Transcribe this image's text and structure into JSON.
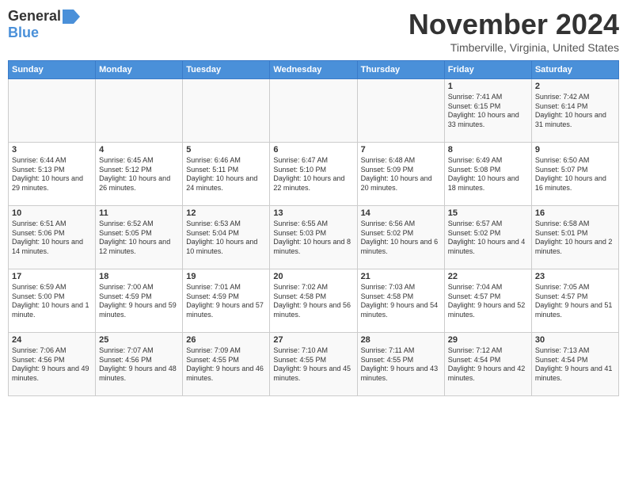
{
  "header": {
    "logo_general": "General",
    "logo_blue": "Blue",
    "month": "November 2024",
    "location": "Timberville, Virginia, United States"
  },
  "days_of_week": [
    "Sunday",
    "Monday",
    "Tuesday",
    "Wednesday",
    "Thursday",
    "Friday",
    "Saturday"
  ],
  "weeks": [
    {
      "cells": [
        {
          "day": null
        },
        {
          "day": null
        },
        {
          "day": null
        },
        {
          "day": null
        },
        {
          "day": null
        },
        {
          "day": "1",
          "sunrise": "7:41 AM",
          "sunset": "6:15 PM",
          "daylight": "10 hours and 33 minutes."
        },
        {
          "day": "2",
          "sunrise": "7:42 AM",
          "sunset": "6:14 PM",
          "daylight": "10 hours and 31 minutes."
        }
      ]
    },
    {
      "cells": [
        {
          "day": "3",
          "sunrise": "6:44 AM",
          "sunset": "5:13 PM",
          "daylight": "10 hours and 29 minutes."
        },
        {
          "day": "4",
          "sunrise": "6:45 AM",
          "sunset": "5:12 PM",
          "daylight": "10 hours and 26 minutes."
        },
        {
          "day": "5",
          "sunrise": "6:46 AM",
          "sunset": "5:11 PM",
          "daylight": "10 hours and 24 minutes."
        },
        {
          "day": "6",
          "sunrise": "6:47 AM",
          "sunset": "5:10 PM",
          "daylight": "10 hours and 22 minutes."
        },
        {
          "day": "7",
          "sunrise": "6:48 AM",
          "sunset": "5:09 PM",
          "daylight": "10 hours and 20 minutes."
        },
        {
          "day": "8",
          "sunrise": "6:49 AM",
          "sunset": "5:08 PM",
          "daylight": "10 hours and 18 minutes."
        },
        {
          "day": "9",
          "sunrise": "6:50 AM",
          "sunset": "5:07 PM",
          "daylight": "10 hours and 16 minutes."
        }
      ]
    },
    {
      "cells": [
        {
          "day": "10",
          "sunrise": "6:51 AM",
          "sunset": "5:06 PM",
          "daylight": "10 hours and 14 minutes."
        },
        {
          "day": "11",
          "sunrise": "6:52 AM",
          "sunset": "5:05 PM",
          "daylight": "10 hours and 12 minutes."
        },
        {
          "day": "12",
          "sunrise": "6:53 AM",
          "sunset": "5:04 PM",
          "daylight": "10 hours and 10 minutes."
        },
        {
          "day": "13",
          "sunrise": "6:55 AM",
          "sunset": "5:03 PM",
          "daylight": "10 hours and 8 minutes."
        },
        {
          "day": "14",
          "sunrise": "6:56 AM",
          "sunset": "5:02 PM",
          "daylight": "10 hours and 6 minutes."
        },
        {
          "day": "15",
          "sunrise": "6:57 AM",
          "sunset": "5:02 PM",
          "daylight": "10 hours and 4 minutes."
        },
        {
          "day": "16",
          "sunrise": "6:58 AM",
          "sunset": "5:01 PM",
          "daylight": "10 hours and 2 minutes."
        }
      ]
    },
    {
      "cells": [
        {
          "day": "17",
          "sunrise": "6:59 AM",
          "sunset": "5:00 PM",
          "daylight": "10 hours and 1 minute."
        },
        {
          "day": "18",
          "sunrise": "7:00 AM",
          "sunset": "4:59 PM",
          "daylight": "9 hours and 59 minutes."
        },
        {
          "day": "19",
          "sunrise": "7:01 AM",
          "sunset": "4:59 PM",
          "daylight": "9 hours and 57 minutes."
        },
        {
          "day": "20",
          "sunrise": "7:02 AM",
          "sunset": "4:58 PM",
          "daylight": "9 hours and 56 minutes."
        },
        {
          "day": "21",
          "sunrise": "7:03 AM",
          "sunset": "4:58 PM",
          "daylight": "9 hours and 54 minutes."
        },
        {
          "day": "22",
          "sunrise": "7:04 AM",
          "sunset": "4:57 PM",
          "daylight": "9 hours and 52 minutes."
        },
        {
          "day": "23",
          "sunrise": "7:05 AM",
          "sunset": "4:57 PM",
          "daylight": "9 hours and 51 minutes."
        }
      ]
    },
    {
      "cells": [
        {
          "day": "24",
          "sunrise": "7:06 AM",
          "sunset": "4:56 PM",
          "daylight": "9 hours and 49 minutes."
        },
        {
          "day": "25",
          "sunrise": "7:07 AM",
          "sunset": "4:56 PM",
          "daylight": "9 hours and 48 minutes."
        },
        {
          "day": "26",
          "sunrise": "7:09 AM",
          "sunset": "4:55 PM",
          "daylight": "9 hours and 46 minutes."
        },
        {
          "day": "27",
          "sunrise": "7:10 AM",
          "sunset": "4:55 PM",
          "daylight": "9 hours and 45 minutes."
        },
        {
          "day": "28",
          "sunrise": "7:11 AM",
          "sunset": "4:55 PM",
          "daylight": "9 hours and 43 minutes."
        },
        {
          "day": "29",
          "sunrise": "7:12 AM",
          "sunset": "4:54 PM",
          "daylight": "9 hours and 42 minutes."
        },
        {
          "day": "30",
          "sunrise": "7:13 AM",
          "sunset": "4:54 PM",
          "daylight": "9 hours and 41 minutes."
        }
      ]
    }
  ]
}
